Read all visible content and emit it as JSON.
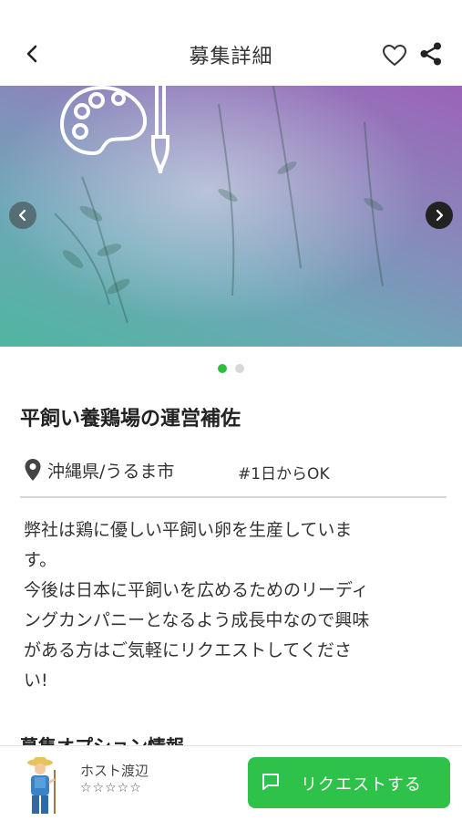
{
  "header": {
    "title": "募集詳細",
    "back_icon": "chevron-left-icon",
    "favorite_icon": "heart-outline-icon",
    "share_icon": "share-icon"
  },
  "hero": {
    "prev_icon": "chevron-left-icon",
    "next_icon": "chevron-right-icon",
    "slide_count": 2,
    "active_slide": 1
  },
  "job": {
    "title": "平飼い養鶏場の運営補佐",
    "location": "沖縄県/うるま市",
    "tag": "#1日からOK",
    "description": "弊社は鶏に優しい平飼い卵を生産していま\nす。\n今後は日本に平飼いを広めるためのリーディ\nングカンパニーとなるよう成長中なので興味\nがある方はご気軽にリクエストしてくださ\nい!",
    "next_section": "募集オプション情報"
  },
  "bottom": {
    "host_name": "ホスト渡辺",
    "rating": "☆☆☆☆☆",
    "request_label": "リクエストする"
  },
  "colors": {
    "accent": "#2fc24a",
    "dot_active": "#2fbd3f",
    "dot_inactive": "#d9d9d9"
  }
}
